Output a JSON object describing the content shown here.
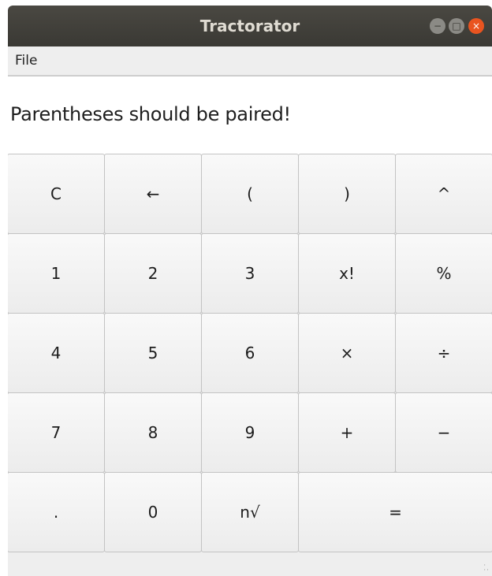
{
  "window": {
    "title": "Tractorator",
    "controls": {
      "minimize_icon": "−",
      "maximize_icon": "□",
      "close_icon": "×"
    }
  },
  "menubar": {
    "items": [
      "File"
    ]
  },
  "display": {
    "text": "Parentheses should be paired!"
  },
  "keypad": {
    "rows": [
      [
        "C",
        "←",
        "(",
        ")",
        "^"
      ],
      [
        "1",
        "2",
        "3",
        "x!",
        "%"
      ],
      [
        "4",
        "5",
        "6",
        "×",
        "÷"
      ],
      [
        "7",
        "8",
        "9",
        "+",
        "−"
      ],
      [
        ".",
        "0",
        "n√",
        "="
      ]
    ]
  },
  "colors": {
    "titlebar": "#3c3b37",
    "close_button": "#e95420",
    "window_bg": "#eeeeee",
    "display_bg": "#ffffff"
  }
}
